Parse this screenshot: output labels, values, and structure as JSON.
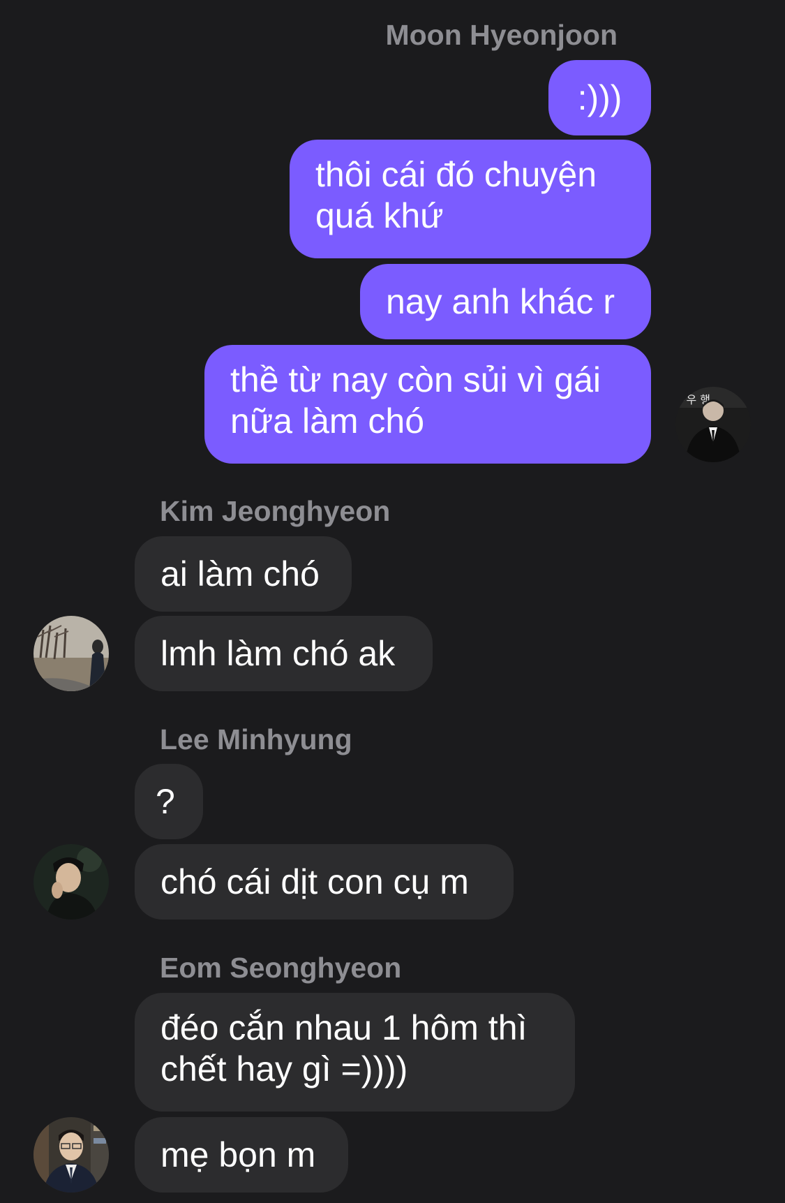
{
  "colors": {
    "background": "#1b1b1d",
    "outgoing_bubble": "#7b5cff",
    "incoming_bubble": "#2c2c2e",
    "sender_name": "#8e8e93",
    "message_text": "#ffffff"
  },
  "groups": [
    {
      "sender": "Moon Hyeonjoon",
      "direction": "outgoing",
      "avatar": "avatar-moon-hyeonjoon",
      "messages": [
        ":)))",
        "thôi cái đó chuyện quá khứ",
        "nay anh khác r",
        "thề từ nay còn sủi vì gái nữa làm chó"
      ]
    },
    {
      "sender": "Kim Jeonghyeon",
      "direction": "incoming",
      "avatar": "avatar-kim-jeonghyeon",
      "messages": [
        "ai làm chó",
        "lmh làm chó ak"
      ]
    },
    {
      "sender": "Lee Minhyung",
      "direction": "incoming",
      "avatar": "avatar-lee-minhyung",
      "messages": [
        "?",
        "chó cái dịt con cụ m"
      ]
    },
    {
      "sender": "Eom Seonghyeon",
      "direction": "incoming",
      "avatar": "avatar-eom-seonghyeon",
      "messages": [
        "đéo cắn nhau 1 hôm thì chết hay gì =))))",
        "mẹ bọn m"
      ]
    }
  ]
}
